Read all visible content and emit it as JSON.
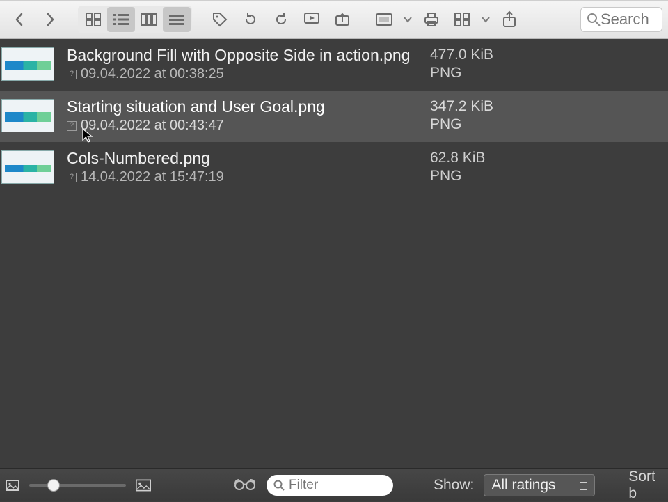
{
  "toolbar": {
    "search_placeholder": "Search"
  },
  "files": [
    {
      "name": "Background Fill with Opposite Side in action.png",
      "date": "09.04.2022 at 00:38:25",
      "size": "477.0 KiB",
      "type": "PNG"
    },
    {
      "name": "Starting situation and User Goal.png",
      "date": "09.04.2022 at 00:43:47",
      "size": "347.2 KiB",
      "type": "PNG"
    },
    {
      "name": "Cols-Numbered.png",
      "date": "14.04.2022 at 15:47:19",
      "size": "62.8 KiB",
      "type": "PNG"
    }
  ],
  "bottombar": {
    "filter_placeholder": "Filter",
    "show_label": "Show:",
    "show_value": "All ratings",
    "sort_label": "Sort b"
  }
}
